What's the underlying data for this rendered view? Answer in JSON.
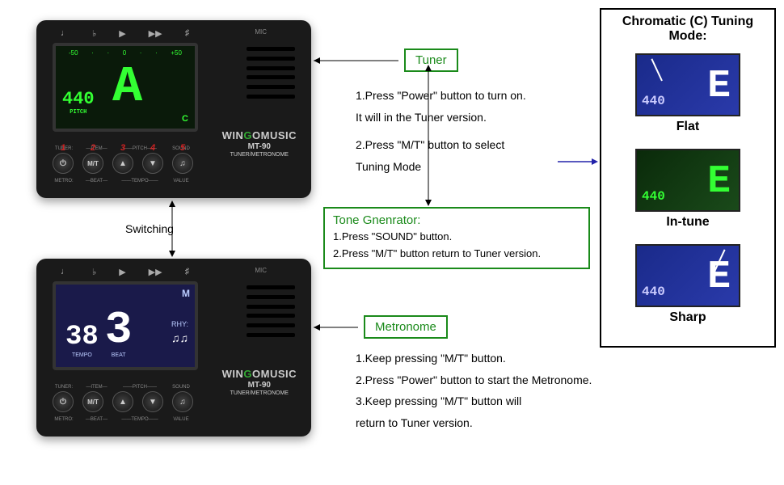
{
  "device": {
    "brand_prefix": "WIN",
    "brand_g": "G",
    "brand_suffix": "OMUSIC",
    "model": "MT-90",
    "desc": "TUNER/METRONOME",
    "mic": "MIC",
    "top_icons": [
      "♩",
      "♭",
      "▶",
      "▶▶",
      "♯"
    ],
    "button_nums": [
      "1",
      "2",
      "3",
      "4",
      "5"
    ],
    "button_glyphs": [
      "⏻",
      "M/T",
      "▲",
      "▼",
      "♫"
    ],
    "labels_top": [
      "TUNER:",
      "ITEM",
      "PITCH",
      "SOUND"
    ],
    "labels_bottom": [
      "METRO:",
      "BEAT",
      "TEMPO",
      "VALUE"
    ]
  },
  "tuner_screen": {
    "freq": "440",
    "note": "A",
    "pitch_label": "PITCH",
    "mode": "C",
    "ticks": [
      "-50",
      "",
      "",
      "0",
      "",
      "",
      "+50"
    ]
  },
  "metro_screen": {
    "tempo": "38",
    "beat": "3",
    "tempo_label": "TEMPO",
    "beat_label": "BEAT",
    "m": "M",
    "rhy": "RHY:",
    "notes": "♫♫"
  },
  "labels": {
    "tuner": "Tuner",
    "metronome": "Metronome",
    "switching": "Switching"
  },
  "instructions": {
    "tuner": [
      "1.Press \"Power\" button to turn on.",
      "It will in the Tuner version.",
      "",
      "2.Press \"M/T\" button to select",
      "Tuning Mode"
    ],
    "metronome": [
      "1.Keep pressing \"M/T\" button.",
      "2.Press \"Power\" button to start the Metronome.",
      "3.Keep pressing \"M/T\" button will",
      "return to Tuner version."
    ],
    "tone_title": "Tone Gnenrator:",
    "tone": [
      "1.Press \"SOUND\" button.",
      "2.Press \"M/T\" button return to Tuner version."
    ]
  },
  "chromatic": {
    "title": "Chromatic (C) Tuning Mode:",
    "items": [
      {
        "label": "Flat",
        "freq": "440",
        "note": "E"
      },
      {
        "label": "In-tune",
        "freq": "440",
        "note": "E"
      },
      {
        "label": "Sharp",
        "freq": "440",
        "note": "E"
      }
    ]
  }
}
